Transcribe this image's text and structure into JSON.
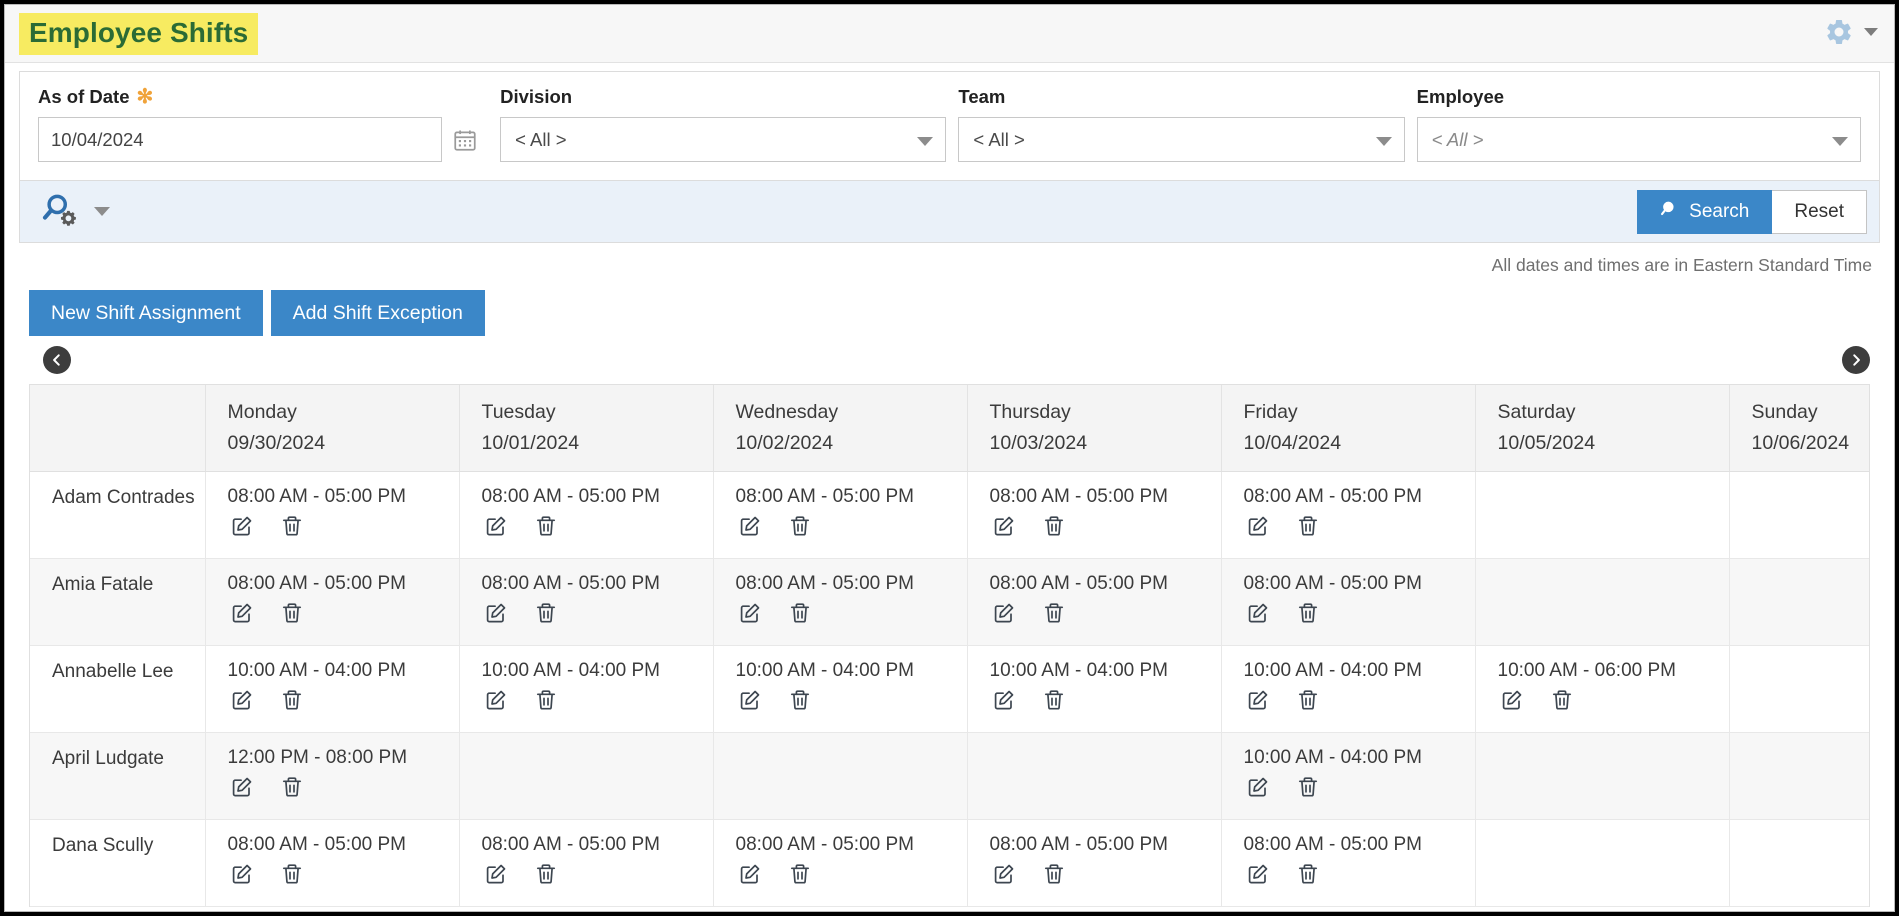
{
  "header": {
    "title": "Employee Shifts",
    "gear_icon": "gear-icon",
    "gear_caret_icon": "chevron-down-icon"
  },
  "filters": {
    "as_of_date": {
      "label": "As of Date",
      "required_marker": "✻",
      "value": "10/04/2024",
      "calendar_icon": "calendar-icon"
    },
    "division": {
      "label": "Division",
      "value": "< All >"
    },
    "team": {
      "label": "Team",
      "value": "< All >"
    },
    "employee": {
      "label": "Employee",
      "value": "< All >"
    }
  },
  "search_bar": {
    "advanced_search_icon": "search-settings-icon",
    "advanced_caret_icon": "chevron-down-icon",
    "search_label": "Search",
    "reset_label": "Reset",
    "search_icon": "search-icon",
    "accent_color": "#3b87c8"
  },
  "notes": {
    "timezone": "All dates and times are in Eastern Standard Time"
  },
  "actions": {
    "new_shift_assignment": "New Shift Assignment",
    "add_shift_exception": "Add Shift Exception"
  },
  "pager": {
    "prev_icon": "chevron-left-circle-icon",
    "next_icon": "chevron-right-circle-icon"
  },
  "schedule": {
    "employee_column_header": "",
    "days": [
      {
        "name": "Monday",
        "date": "09/30/2024"
      },
      {
        "name": "Tuesday",
        "date": "10/01/2024"
      },
      {
        "name": "Wednesday",
        "date": "10/02/2024"
      },
      {
        "name": "Thursday",
        "date": "10/03/2024"
      },
      {
        "name": "Friday",
        "date": "10/04/2024"
      },
      {
        "name": "Saturday",
        "date": "10/05/2024"
      },
      {
        "name": "Sunday",
        "date": "10/06/2024"
      }
    ],
    "edit_icon": "edit-icon",
    "delete_icon": "trash-icon",
    "rows": [
      {
        "employee": "Adam Contrades",
        "shifts": [
          "08:00 AM - 05:00 PM",
          "08:00 AM - 05:00 PM",
          "08:00 AM - 05:00 PM",
          "08:00 AM - 05:00 PM",
          "08:00 AM - 05:00 PM",
          "",
          ""
        ]
      },
      {
        "employee": "Amia Fatale",
        "shifts": [
          "08:00 AM - 05:00 PM",
          "08:00 AM - 05:00 PM",
          "08:00 AM - 05:00 PM",
          "08:00 AM - 05:00 PM",
          "08:00 AM - 05:00 PM",
          "",
          ""
        ]
      },
      {
        "employee": "Annabelle Lee",
        "shifts": [
          "10:00 AM - 04:00 PM",
          "10:00 AM - 04:00 PM",
          "10:00 AM - 04:00 PM",
          "10:00 AM - 04:00 PM",
          "10:00 AM - 04:00 PM",
          "10:00 AM - 06:00 PM",
          ""
        ]
      },
      {
        "employee": "April Ludgate",
        "shifts": [
          "12:00 PM - 08:00 PM",
          "",
          "",
          "",
          "10:00 AM - 04:00 PM",
          "",
          ""
        ]
      },
      {
        "employee": "Dana Scully",
        "shifts": [
          "08:00 AM - 05:00 PM",
          "08:00 AM - 05:00 PM",
          "08:00 AM - 05:00 PM",
          "08:00 AM - 05:00 PM",
          "08:00 AM - 05:00 PM",
          "",
          ""
        ]
      }
    ]
  }
}
